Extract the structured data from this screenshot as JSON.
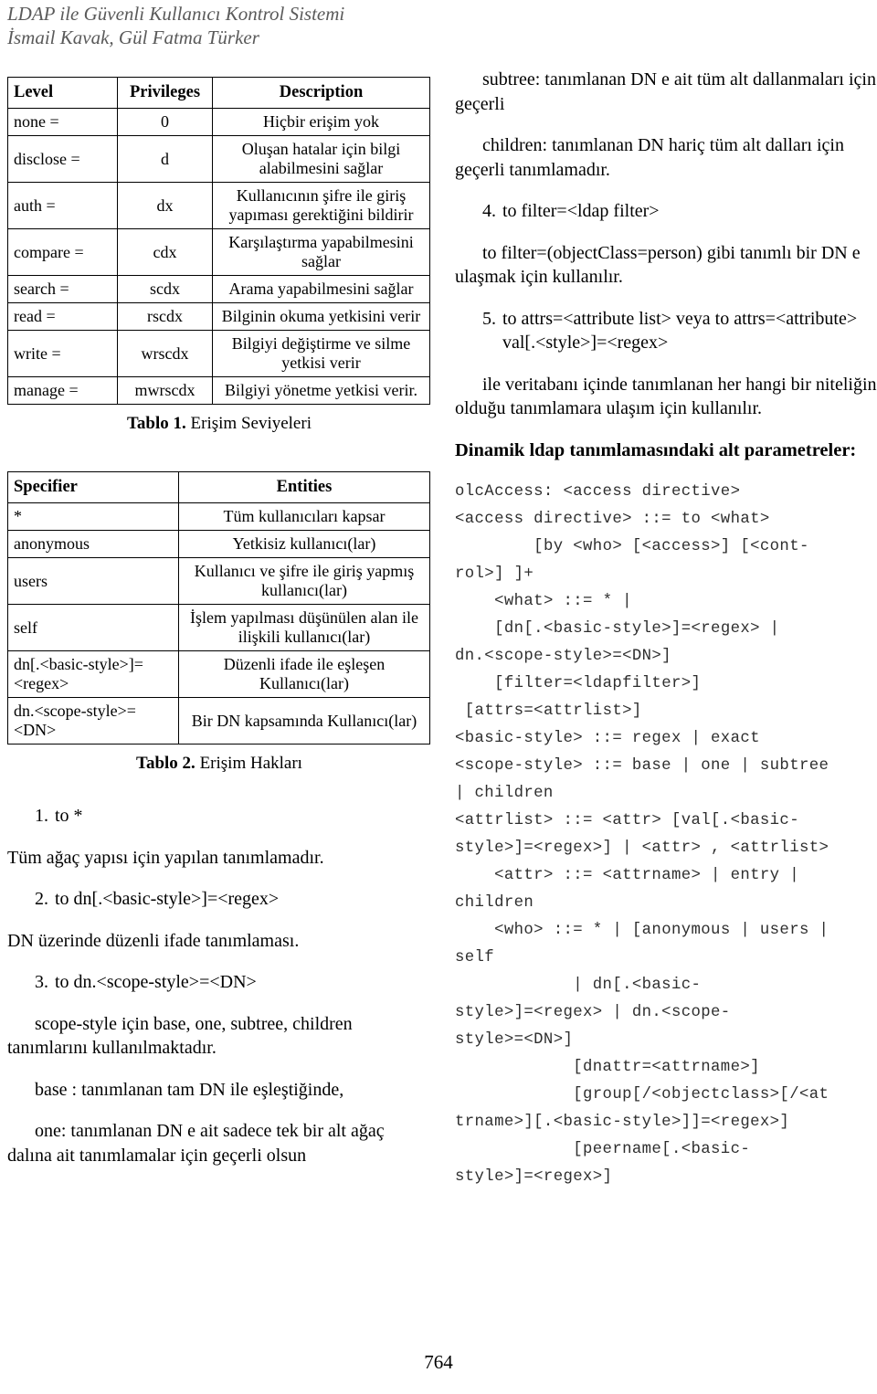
{
  "running_head": {
    "title": "LDAP ile Güvenli Kullanıcı Kontrol Sistemi",
    "authors": "İsmail Kavak, Gül Fatma Türker"
  },
  "table1": {
    "headers": [
      "Level",
      "Privileges",
      "Description"
    ],
    "rows": [
      [
        "none = ",
        "0",
        "Hiçbir erişim yok"
      ],
      [
        "disclose = ",
        "d",
        "Oluşan hatalar için bilgi alabilmesini sağlar"
      ],
      [
        "auth = ",
        "dx",
        "Kullanıcının şifre ile giriş yapıması gerektiğini bildirir"
      ],
      [
        "compare = ",
        "cdx",
        "Karşılaştırma yapabilmesini sağlar"
      ],
      [
        "search = ",
        "scdx",
        "Arama yapabilmesini sağlar"
      ],
      [
        "read = ",
        "rscdx",
        "Bilginin okuma yetkisini verir"
      ],
      [
        "write = ",
        "wrscdx",
        "Bilgiyi değiştirme ve silme yetkisi verir"
      ],
      [
        "manage = ",
        "mwrscdx",
        "Bilgiyi yönetme yetkisi verir."
      ]
    ],
    "caption_label": "Tablo 1.",
    "caption_text": " Erişim Seviyeleri"
  },
  "table2": {
    "headers": [
      "Specifier",
      "Entities"
    ],
    "rows": [
      [
        "*",
        "Tüm kullanıcıları kapsar"
      ],
      [
        "anonymous",
        "Yetkisiz kullanıcı(lar)"
      ],
      [
        "users",
        "Kullanıcı ve şifre ile giriş yapmış kullanıcı(lar)"
      ],
      [
        "self",
        "İşlem yapılması düşünülen alan ile ilişkili kullanıcı(lar)"
      ],
      [
        "dn[.<basic-style>]=<regex>",
        "Düzenli ifade ile eşleşen Kullanıcı(lar)"
      ],
      [
        "dn.<scope-style>=<DN>",
        "Bir DN kapsamında Kullanıcı(lar)"
      ]
    ],
    "caption_label": "Tablo 2.",
    "caption_text": " Erişim Hakları"
  },
  "left_column": {
    "item1_num": "1.",
    "item1_text": "to *",
    "para1": "Tüm ağaç yapısı için yapılan tanımlamadır.",
    "item2_num": "2.",
    "item2_text": "to dn[.<basic-style>]=<regex>",
    "para2": "DN üzerinde düzenli ifade tanımlaması.",
    "item3_num": "3.",
    "item3_text": "to dn.<scope-style>=<DN>",
    "para3": "scope-style için base, one, subtree, children tanımlarını kullanılmaktadır.",
    "para4": "base : tanımlanan tam DN ile eşleştiğinde,",
    "para5": "one: tanımlanan DN e ait sadece tek bir alt ağaç dalına ait tanımlamalar için geçerli olsun"
  },
  "right_column": {
    "para1": "subtree: tanımlanan DN e ait tüm alt dallanmaları için geçerli",
    "para2": "children:  tanımlanan DN hariç tüm alt dalları için geçerli tanımlamadır.",
    "item4_num": "4.",
    "item4_text": "to  filter=<ldap filter>",
    "para3": "to filter=(objectClass=person) gibi tanımlı bir DN e ulaşmak için kullanılır.",
    "item5_num": "5.",
    "item5_text": "to attrs=<attribute list>     veya    to attrs=<attribute> val[.<style>]=<regex>",
    "para4": "ile veritabanı içinde tanımlanan her hangi bir niteliğin olduğu tanımlamara ulaşım için kullanılır.",
    "subheading": "Dinamik ldap tanımlamasındaki alt parametreler:",
    "code": "olcAccess: <access directive>\n<access directive> ::= to <what>\n        [by <who> [<access>] [<cont-\nrol>] ]+\n    <what> ::= * |\n    [dn[.<basic-style>]=<regex> |\ndn.<scope-style>=<DN>]\n    [filter=<ldapfilter>]\n [attrs=<attrlist>]\n<basic-style> ::= regex | exact\n<scope-style> ::= base | one | subtree\n| children\n<attrlist> ::= <attr> [val[.<basic-\nstyle>]=<regex>] | <attr> , <attrlist>\n    <attr> ::= <attrname> | entry |\nchildren\n    <who> ::= * | [anonymous | users |\nself\n            | dn[.<basic-\nstyle>]=<regex> | dn.<scope-\nstyle>=<DN>]\n            [dnattr=<attrname>]\n            [group[/<objectclass>[/<at\ntrname>][.<basic-style>]]=<regex>]\n            [peername[.<basic-\nstyle>]=<regex>]"
  },
  "footer": {
    "page_number": "764"
  }
}
